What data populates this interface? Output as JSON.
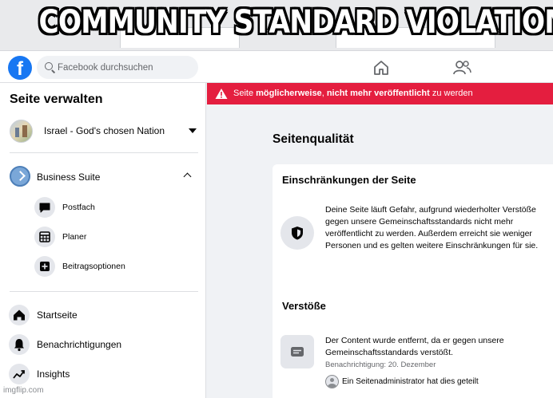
{
  "meme": {
    "caption": "COMMUNITY STANDARD VIOLATION"
  },
  "topbar": {
    "search_placeholder": "Facebook durchsuchen",
    "home_icon": "home-icon",
    "friends_icon": "friends-icon",
    "brand_color": "#1877f2"
  },
  "sidebar": {
    "title": "Seite verwalten",
    "page_name": "Israel - God's chosen Nation",
    "business_suite": "Business Suite",
    "sub_items": [
      {
        "label": "Postfach",
        "icon": "chat-bubble-icon"
      },
      {
        "label": "Planer",
        "icon": "calendar-grid-icon"
      },
      {
        "label": "Beitragsoptionen",
        "icon": "post-options-icon"
      }
    ],
    "main_items": [
      {
        "label": "Startseite",
        "icon": "home-icon"
      },
      {
        "label": "Benachrichtigungen",
        "icon": "bell-icon"
      },
      {
        "label": "Insights",
        "icon": "trend-icon"
      }
    ]
  },
  "alert": {
    "part1": "Seite ",
    "bold1": "möglicherweise",
    "part2": ", ",
    "bold2": "nicht mehr veröffentlicht",
    "part3": " zu werden",
    "color": "#e41e3f"
  },
  "main": {
    "section_title": "Seitenqualität",
    "restrictions_title": "Einschränkungen der Seite",
    "restrictions_text": "Deine Seite läuft Gefahr, aufgrund wiederholter Verstöße gegen unsere Gemeinschaftsstandards nicht mehr veröffentlicht zu werden. Außerdem erreicht sie weniger Personen und es gelten weitere Einschränkungen für sie.",
    "violations_title": "Verstöße",
    "violation_text": "Der Content wurde entfernt, da er gegen unsere Gemeinschaftsstandards verstößt.",
    "violation_date": "Benachrichtigung: 20. Dezember",
    "admin_name": "Ein Seitenadministrator",
    "admin_suffix": " hat dies geteilt"
  },
  "watermark": "imgflip.com"
}
